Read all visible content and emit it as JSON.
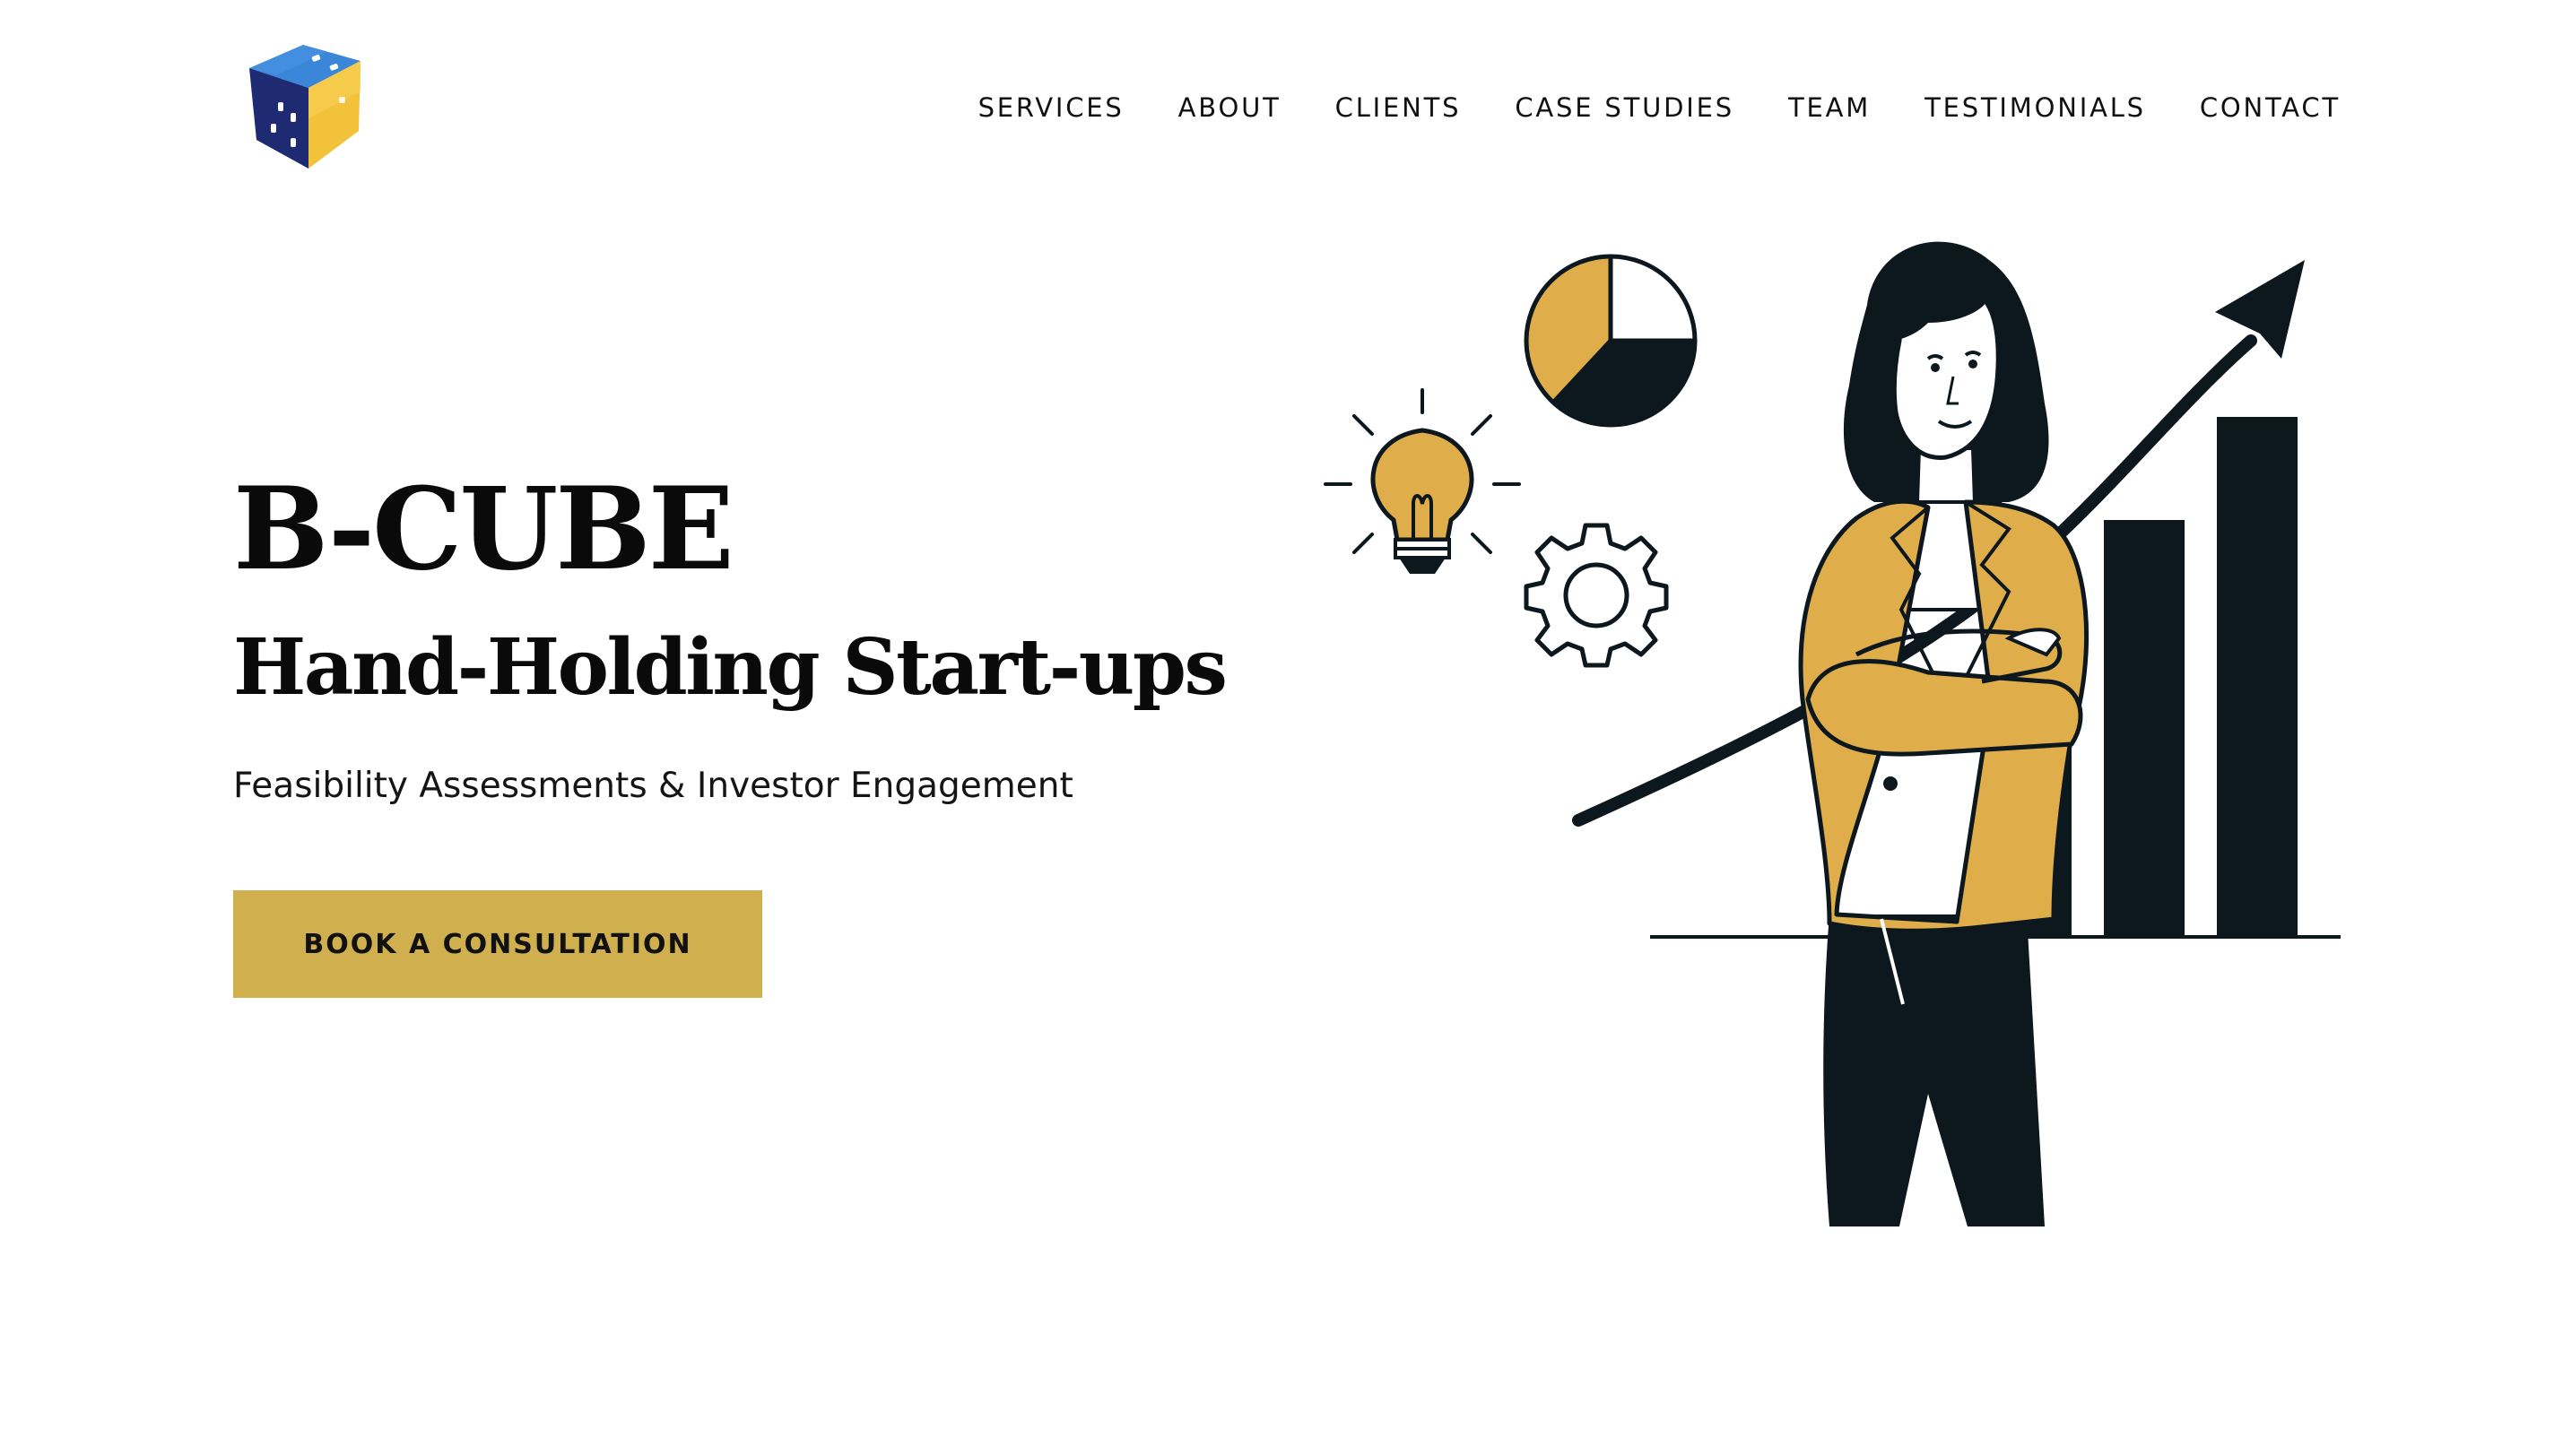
{
  "brand": {
    "logo_icon": "dice-cube-logo",
    "colors": {
      "navy": "#1f2f78",
      "blue": "#2f7fd6",
      "gold": "#f2c23a",
      "accent": "#d0b04e",
      "dark": "#0d171e",
      "mustard": "#dfae4b"
    }
  },
  "nav": {
    "items": [
      {
        "label": "SERVICES"
      },
      {
        "label": "ABOUT"
      },
      {
        "label": "CLIENTS"
      },
      {
        "label": "CASE STUDIES"
      },
      {
        "label": "TEAM"
      },
      {
        "label": "TESTIMONIALS"
      },
      {
        "label": "CONTACT"
      }
    ]
  },
  "hero": {
    "title": "B-CUBE",
    "subtitle": "Hand-Holding Start-ups",
    "tagline": "Feasibility Assessments & Investor Engagement",
    "cta_label": "BOOK A CONSULTATION"
  },
  "illustration": {
    "icons": [
      "lightbulb-icon",
      "pie-chart-icon",
      "gear-icon",
      "trend-arrow-icon",
      "bar-chart-icon",
      "businesswoman-figure"
    ]
  }
}
